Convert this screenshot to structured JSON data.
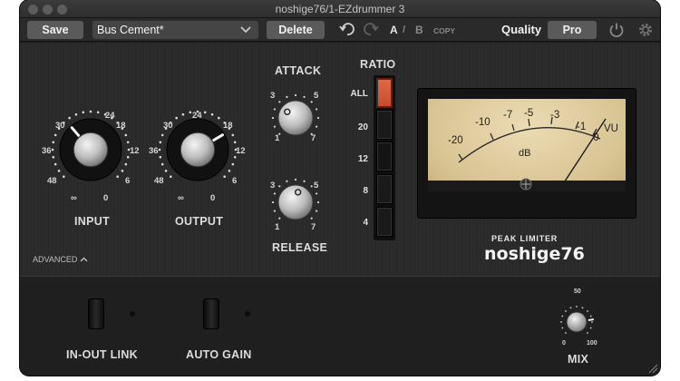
{
  "window": {
    "title": "noshige76/1-EZdrummer 3"
  },
  "toolbar": {
    "save_label": "Save",
    "preset_name": "Bus Cement*",
    "delete_label": "Delete",
    "a_label": "A",
    "slash": "/",
    "b_label": "B",
    "copy_label": "COPY",
    "quality_label": "Quality",
    "quality_value": "Pro"
  },
  "input": {
    "label": "INPUT",
    "scale": [
      "24",
      "18",
      "12",
      "6",
      "0",
      "∞",
      "48",
      "36",
      "30"
    ],
    "value_fraction": 0.35
  },
  "output": {
    "label": "OUTPUT",
    "scale": [
      "24",
      "18",
      "12",
      "6",
      "0",
      "∞",
      "48",
      "36",
      "30"
    ],
    "value_fraction": 0.72
  },
  "attack": {
    "label": "ATTACK",
    "scale": [
      "3",
      "5",
      "1",
      "7"
    ],
    "value_fraction": 0.3
  },
  "release": {
    "label": "RELEASE",
    "scale": [
      "3",
      "5",
      "1",
      "7"
    ],
    "value_fraction": 0.55
  },
  "ratio": {
    "label": "RATIO",
    "options": [
      "ALL",
      "20",
      "12",
      "8",
      "4"
    ],
    "selected": "ALL"
  },
  "vu": {
    "scale": [
      "-20",
      "-10",
      "-7",
      "-5",
      "-3",
      "-1",
      "0"
    ],
    "unit": "dB",
    "vu_label": "VU"
  },
  "brand": {
    "subtitle": "PEAK LIMITER",
    "name": "noshige76"
  },
  "advanced": {
    "label": "ADVANCED"
  },
  "inout": {
    "label": "IN-OUT LINK"
  },
  "autogain": {
    "label": "AUTO GAIN"
  },
  "mix": {
    "label": "MIX",
    "scale": [
      "50",
      "0",
      "100"
    ],
    "value_fraction": 0.8
  },
  "colors": {
    "accent": "#d9583a",
    "meter_face": "#e3d2a6",
    "panel": "#2a2a2a"
  }
}
